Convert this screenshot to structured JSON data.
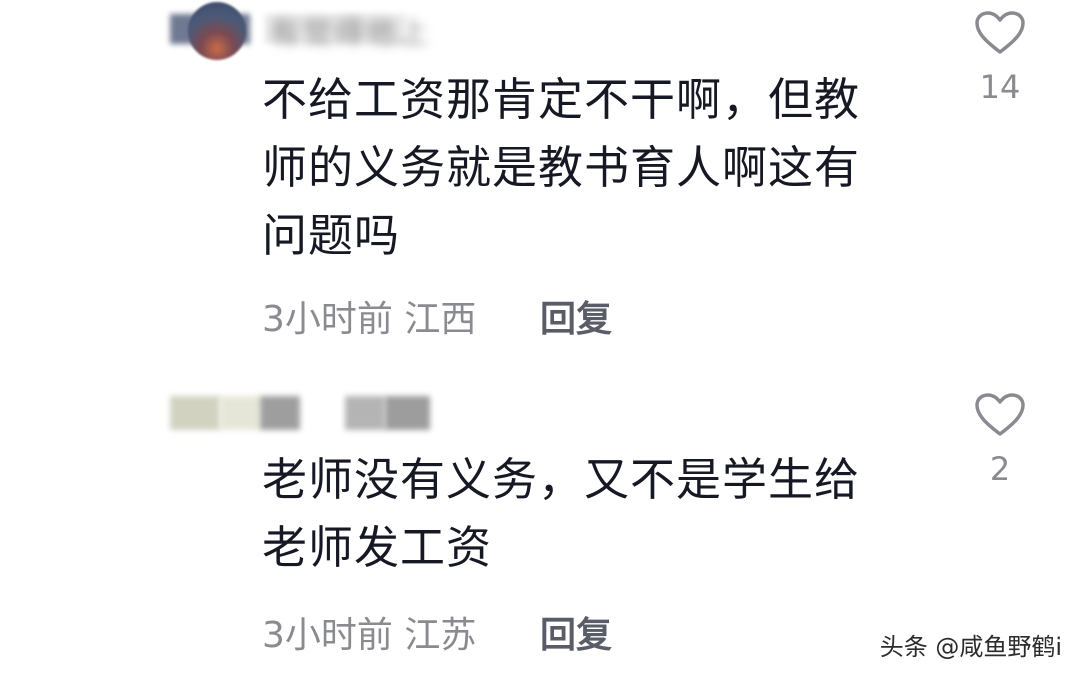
{
  "comments": [
    {
      "username": "有觉得他上",
      "text": "不给工资那肯定不干啊，但教师的义务就是教书育人啊这有问题吗",
      "time": "3小时前",
      "location": "江西",
      "reply_label": "回复",
      "like_count": "14"
    },
    {
      "username": "",
      "text": "老师没有义务，又不是学生给老师发工资",
      "time": "3小时前",
      "location": "江苏",
      "reply_label": "回复",
      "like_count": "2"
    }
  ],
  "watermark": "头条 @咸鱼野鹤i",
  "icons": {
    "like": "heart-icon"
  }
}
